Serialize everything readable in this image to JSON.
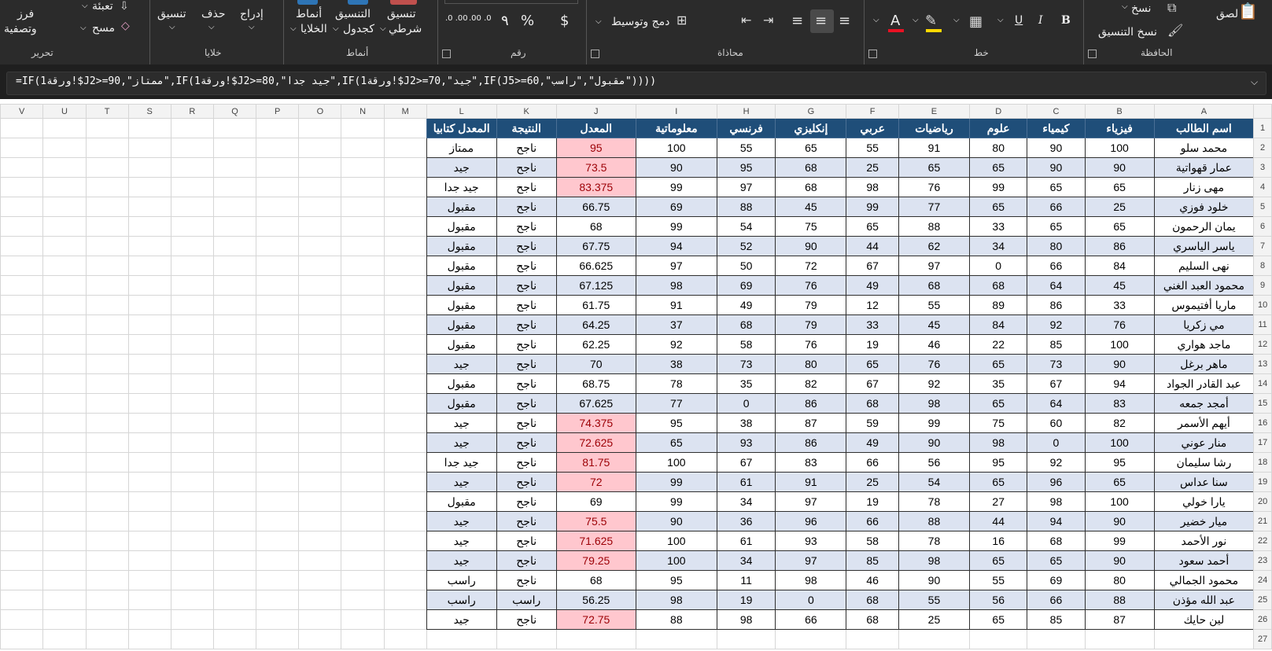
{
  "ribbon": {
    "groups": {
      "clipboard": "الحافظة",
      "font": "خط",
      "alignment": "محاذاة",
      "number": "رقم",
      "styles": "أنماط",
      "cells": "خلايا",
      "editing": "تحرير"
    },
    "paste": "لصق",
    "copy": "نسخ",
    "format_painter": "نسخ التنسيق",
    "bold": "B",
    "italic": "I",
    "underline": "U",
    "font_color_glyph": "A",
    "merge_center": "دمج وتوسيط",
    "currency": "$",
    "percent": "%",
    "comma": "٩",
    "dec_increase": ".00 .0",
    "dec_decrease": ".0 .00",
    "conditional_formatting": [
      "تنسيق",
      "شرطي"
    ],
    "format_as_table": [
      "التنسيق",
      "كجدول"
    ],
    "cell_styles": [
      "أنماط",
      "الخلايا"
    ],
    "insert": "إدراج",
    "delete": "حذف",
    "format": "تنسيق",
    "fill": "تعبئة",
    "clear": "مسح",
    "sort_filter": [
      "فرز",
      "وتصفية"
    ],
    "accent_colors": {
      "font_color": "#e81123",
      "highlight": "#ffd800",
      "formula_pink": "#ffc7ce",
      "header_blue": "#1f4e79"
    }
  },
  "formula_bar": {
    "formula": "=IF(1ورقة!$J2>=90,\"ممتاز\",IF(1ورقة!$J2>=80,\"جيد جدا\",IF(1ورقة!$J2>=70,\"جيد\",IF(J5>=60,\"مقبول\",\"راسب\"))))"
  },
  "sheet": {
    "columns": [
      "A",
      "B",
      "C",
      "D",
      "E",
      "F",
      "G",
      "H",
      "I",
      "J",
      "K",
      "L",
      "M",
      "N",
      "O",
      "P",
      "Q",
      "R",
      "S",
      "T",
      "U",
      "V"
    ],
    "headers": [
      "اسم الطالب",
      "فيزياء",
      "كيمياء",
      "علوم",
      "رياضيات",
      "عربي",
      "إنكليزي",
      "فرنسي",
      "معلوماتية",
      "المعدل",
      "النتيجة",
      "المعدل كتابيا"
    ],
    "rows": [
      {
        "name": "محمد سلو",
        "physics": "100",
        "chemistry": "90",
        "science": "80",
        "math": "91",
        "arabic": "55",
        "english": "65",
        "french": "55",
        "it": "100",
        "avg": "95",
        "result": "ناجح",
        "grade": "ممتاز",
        "hi": true
      },
      {
        "name": "عمار قهواتية",
        "physics": "90",
        "chemistry": "90",
        "science": "65",
        "math": "65",
        "arabic": "25",
        "english": "68",
        "french": "95",
        "it": "90",
        "avg": "73.5",
        "result": "ناجح",
        "grade": "جيد",
        "hi": true
      },
      {
        "name": "مهى زنار",
        "physics": "65",
        "chemistry": "65",
        "science": "99",
        "math": "76",
        "arabic": "98",
        "english": "68",
        "french": "97",
        "it": "99",
        "avg": "83.375",
        "result": "ناجح",
        "grade": "جيد جدا",
        "hi": true
      },
      {
        "name": "خلود فوزي",
        "physics": "25",
        "chemistry": "66",
        "science": "65",
        "math": "77",
        "arabic": "99",
        "english": "45",
        "french": "88",
        "it": "69",
        "avg": "66.75",
        "result": "ناجح",
        "grade": "مقبول",
        "hi": false
      },
      {
        "name": "يمان الرحمون",
        "physics": "65",
        "chemistry": "65",
        "science": "33",
        "math": "88",
        "arabic": "65",
        "english": "75",
        "french": "54",
        "it": "99",
        "avg": "68",
        "result": "ناجح",
        "grade": "مقبول",
        "hi": false
      },
      {
        "name": "ياسر الياسري",
        "physics": "86",
        "chemistry": "80",
        "science": "34",
        "math": "62",
        "arabic": "44",
        "english": "90",
        "french": "52",
        "it": "94",
        "avg": "67.75",
        "result": "ناجح",
        "grade": "مقبول",
        "hi": false
      },
      {
        "name": "نهى السليم",
        "physics": "84",
        "chemistry": "66",
        "science": "0",
        "math": "97",
        "arabic": "67",
        "english": "72",
        "french": "50",
        "it": "97",
        "avg": "66.625",
        "result": "ناجح",
        "grade": "مقبول",
        "hi": false
      },
      {
        "name": "محمود العبد الغني",
        "physics": "45",
        "chemistry": "64",
        "science": "68",
        "math": "68",
        "arabic": "49",
        "english": "76",
        "french": "69",
        "it": "98",
        "avg": "67.125",
        "result": "ناجح",
        "grade": "مقبول",
        "hi": false
      },
      {
        "name": "ماريا أفتيموس",
        "physics": "33",
        "chemistry": "86",
        "science": "89",
        "math": "55",
        "arabic": "12",
        "english": "79",
        "french": "49",
        "it": "91",
        "avg": "61.75",
        "result": "ناجح",
        "grade": "مقبول",
        "hi": false
      },
      {
        "name": "مي زكريا",
        "physics": "76",
        "chemistry": "92",
        "science": "84",
        "math": "45",
        "arabic": "33",
        "english": "79",
        "french": "68",
        "it": "37",
        "avg": "64.25",
        "result": "ناجح",
        "grade": "مقبول",
        "hi": false
      },
      {
        "name": "ماجد هواري",
        "physics": "100",
        "chemistry": "85",
        "science": "22",
        "math": "46",
        "arabic": "19",
        "english": "76",
        "french": "58",
        "it": "92",
        "avg": "62.25",
        "result": "ناجح",
        "grade": "مقبول",
        "hi": false
      },
      {
        "name": "ماهر برغل",
        "physics": "90",
        "chemistry": "73",
        "science": "65",
        "math": "76",
        "arabic": "65",
        "english": "80",
        "french": "73",
        "it": "38",
        "avg": "70",
        "result": "ناجح",
        "grade": "جيد",
        "hi": false
      },
      {
        "name": "عبد القادر الجواد",
        "physics": "94",
        "chemistry": "67",
        "science": "35",
        "math": "92",
        "arabic": "67",
        "english": "82",
        "french": "35",
        "it": "78",
        "avg": "68.75",
        "result": "ناجح",
        "grade": "مقبول",
        "hi": false
      },
      {
        "name": "أمجد جمعه",
        "physics": "83",
        "chemistry": "64",
        "science": "65",
        "math": "98",
        "arabic": "68",
        "english": "86",
        "french": "0",
        "it": "77",
        "avg": "67.625",
        "result": "ناجح",
        "grade": "مقبول",
        "hi": false
      },
      {
        "name": "أيهم الأسمر",
        "physics": "82",
        "chemistry": "60",
        "science": "75",
        "math": "99",
        "arabic": "59",
        "english": "87",
        "french": "38",
        "it": "95",
        "avg": "74.375",
        "result": "ناجح",
        "grade": "جيد",
        "hi": true
      },
      {
        "name": "منار عوني",
        "physics": "100",
        "chemistry": "0",
        "science": "98",
        "math": "90",
        "arabic": "49",
        "english": "86",
        "french": "93",
        "it": "65",
        "avg": "72.625",
        "result": "ناجح",
        "grade": "جيد",
        "hi": true
      },
      {
        "name": "رشا سليمان",
        "physics": "95",
        "chemistry": "92",
        "science": "95",
        "math": "56",
        "arabic": "66",
        "english": "83",
        "french": "67",
        "it": "100",
        "avg": "81.75",
        "result": "ناجح",
        "grade": "جيد جدا",
        "hi": true
      },
      {
        "name": "سنا عداس",
        "physics": "65",
        "chemistry": "96",
        "science": "65",
        "math": "54",
        "arabic": "25",
        "english": "91",
        "french": "61",
        "it": "99",
        "avg": "72",
        "result": "ناجح",
        "grade": "جيد",
        "hi": true
      },
      {
        "name": "يارا خولي",
        "physics": "100",
        "chemistry": "98",
        "science": "27",
        "math": "78",
        "arabic": "19",
        "english": "97",
        "french": "34",
        "it": "99",
        "avg": "69",
        "result": "ناجح",
        "grade": "مقبول",
        "hi": false
      },
      {
        "name": "ميار خضير",
        "physics": "90",
        "chemistry": "94",
        "science": "44",
        "math": "88",
        "arabic": "66",
        "english": "96",
        "french": "36",
        "it": "90",
        "avg": "75.5",
        "result": "ناجح",
        "grade": "جيد",
        "hi": true
      },
      {
        "name": "نور الأحمد",
        "physics": "99",
        "chemistry": "68",
        "science": "16",
        "math": "78",
        "arabic": "58",
        "english": "93",
        "french": "61",
        "it": "100",
        "avg": "71.625",
        "result": "ناجح",
        "grade": "جيد",
        "hi": true
      },
      {
        "name": "أحمد سعود",
        "physics": "90",
        "chemistry": "65",
        "science": "65",
        "math": "98",
        "arabic": "85",
        "english": "97",
        "french": "34",
        "it": "100",
        "avg": "79.25",
        "result": "ناجح",
        "grade": "جيد",
        "hi": true
      },
      {
        "name": "محمود الجمالي",
        "physics": "80",
        "chemistry": "69",
        "science": "55",
        "math": "90",
        "arabic": "46",
        "english": "98",
        "french": "11",
        "it": "95",
        "avg": "68",
        "result": "ناجح",
        "grade": "راسب",
        "hi": false
      },
      {
        "name": "عبد الله مؤذن",
        "physics": "88",
        "chemistry": "66",
        "science": "56",
        "math": "55",
        "arabic": "68",
        "english": "0",
        "french": "19",
        "it": "98",
        "avg": "56.25",
        "result": "راسب",
        "grade": "راسب",
        "hi": false
      },
      {
        "name": "لين حايك",
        "physics": "87",
        "chemistry": "85",
        "science": "65",
        "math": "25",
        "arabic": "68",
        "english": "66",
        "french": "98",
        "it": "88",
        "avg": "72.75",
        "result": "ناجح",
        "grade": "جيد",
        "hi": true
      }
    ]
  }
}
